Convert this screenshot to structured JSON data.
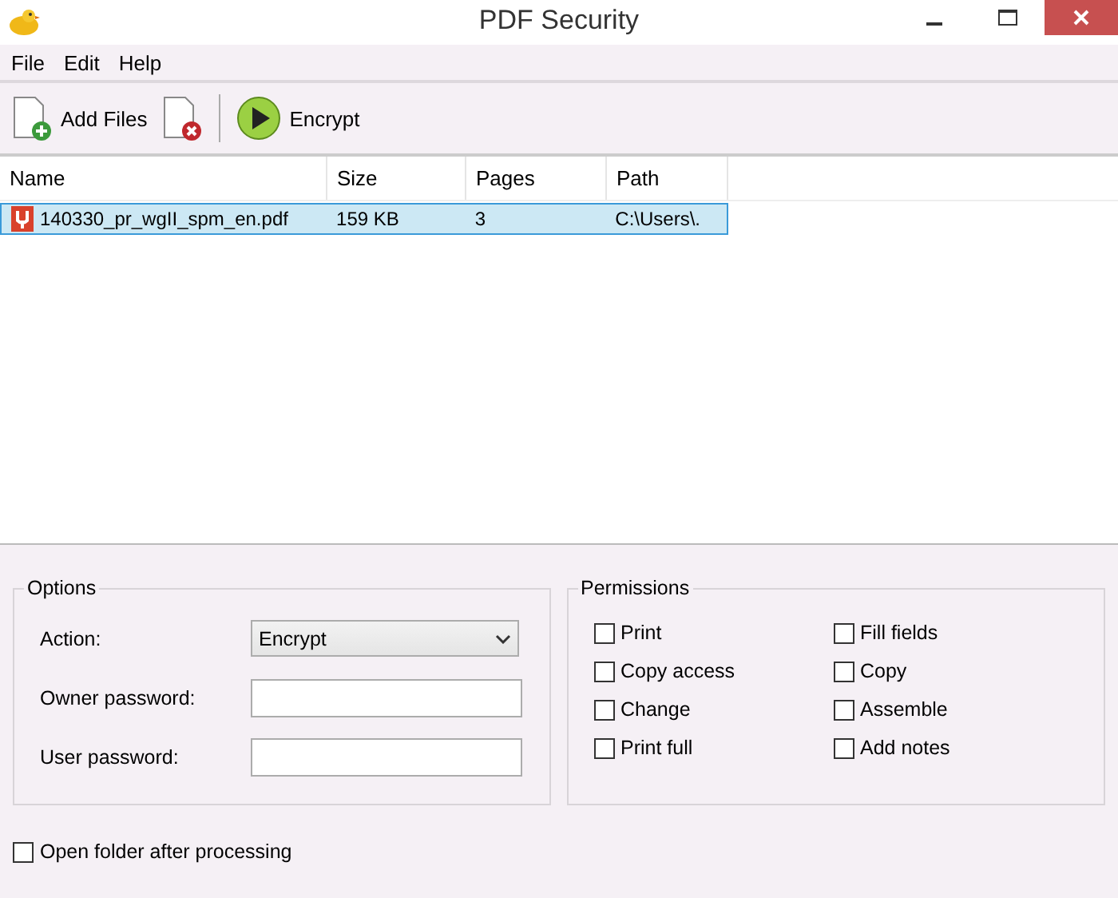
{
  "window": {
    "title": "PDF Security"
  },
  "menu": [
    "File",
    "Edit",
    "Help"
  ],
  "toolbar": [
    {
      "kind": "add",
      "label": "Add Files"
    },
    {
      "kind": "remove"
    },
    {
      "kind": "separator"
    },
    {
      "kind": "play",
      "label": "Encrypt"
    }
  ],
  "table": {
    "columns": [
      "Name",
      "Size",
      "Pages",
      "Path"
    ],
    "rows": [
      {
        "selected": true,
        "cells": [
          "140330_pr_wgII_spm_en.pdf",
          "159 KB",
          "3",
          "C:\\Users\\."
        ]
      }
    ]
  },
  "options": {
    "title": "Options",
    "action_label": "Action:",
    "action_value": "Encrypt",
    "owner_label": "Owner password:",
    "user_label": "User password:"
  },
  "permissions": {
    "title": "Permissions",
    "items": [
      {
        "label": "Print",
        "checked": false
      },
      {
        "label": "Fill fields",
        "checked": false
      },
      {
        "label": "Copy access",
        "checked": false
      },
      {
        "label": "Copy",
        "checked": false
      },
      {
        "label": "Change",
        "checked": false
      },
      {
        "label": "Assemble",
        "checked": false
      },
      {
        "label": "Print full",
        "checked": false
      },
      {
        "label": "Add notes",
        "checked": false
      }
    ]
  },
  "open_folder": {
    "label": "Open folder after processing",
    "checked": false
  }
}
